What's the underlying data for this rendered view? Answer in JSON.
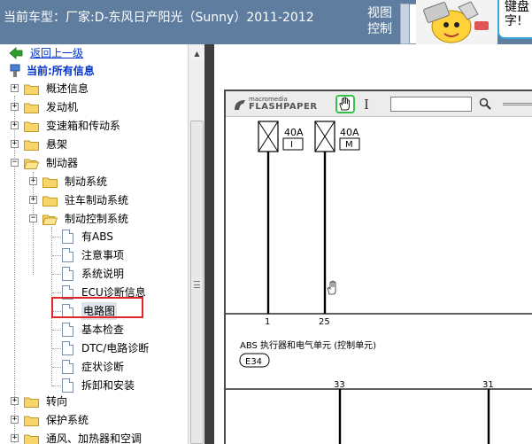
{
  "titlebar": {
    "car_model_label": "当前车型：厂家:D-东风日产阳光（Sunny）2011-2012",
    "view_control": "视图控制",
    "bubble_line1": "键盘",
    "bubble_line2": "字!"
  },
  "tree": {
    "back": "返回上一级",
    "current": "当前:所有信息",
    "items": [
      {
        "label": "概述信息",
        "pm": "+"
      },
      {
        "label": "发动机",
        "pm": "+"
      },
      {
        "label": "变速箱和传动系",
        "pm": "+"
      },
      {
        "label": "悬架",
        "pm": "+"
      },
      {
        "label": "制动器",
        "pm": "−"
      },
      {
        "label": "制动系统",
        "pm": "+"
      },
      {
        "label": "驻车制动系统",
        "pm": "+"
      },
      {
        "label": "制动控制系统",
        "pm": "−"
      },
      {
        "label": "有ABS"
      },
      {
        "label": "注意事项"
      },
      {
        "label": "系统说明"
      },
      {
        "label": "ECU诊断信息"
      },
      {
        "label": "电路图"
      },
      {
        "label": "基本检查"
      },
      {
        "label": "DTC/电路诊断"
      },
      {
        "label": "症状诊断"
      },
      {
        "label": "拆卸和安装"
      },
      {
        "label": "转向",
        "pm": "+"
      },
      {
        "label": "保护系统",
        "pm": "+"
      },
      {
        "label": "通风、加热器和空调",
        "pm": "+"
      }
    ]
  },
  "viewer": {
    "logo_top": "macromedia",
    "logo_bottom": "FLASHPAPER",
    "search_value": "",
    "diagram": {
      "fuse1_amp": "40A",
      "fuse1_id": "I",
      "fuse2_amp": "40A",
      "fuse2_id": "M",
      "pin1": "1",
      "pin2": "25",
      "unit_label": "ABS 执行器和电气单元 (控制单元)",
      "connector": "E34",
      "pin3": "33",
      "pin4": "31"
    }
  },
  "colors": {
    "titlebar_bg": "#5f7d9e",
    "link": "#0033cc",
    "highlight_box": "#e0262a",
    "splitter": "#3e3e3e"
  }
}
